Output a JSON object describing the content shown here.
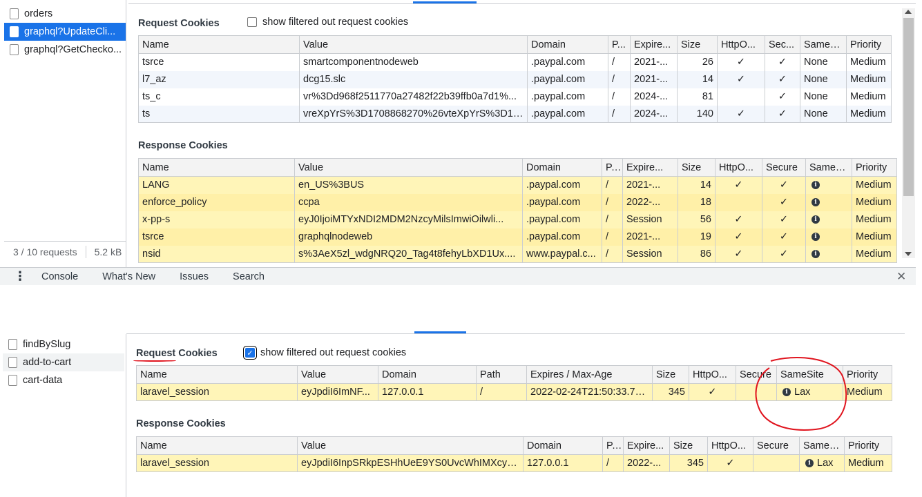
{
  "top": {
    "requests": [
      {
        "name": "orders"
      },
      {
        "name": "graphql?UpdateCli..."
      },
      {
        "name": "graphql?GetChecko..."
      }
    ],
    "status": {
      "requests": "3 / 10 requests",
      "size": "5.2 kB"
    },
    "request_cookies": {
      "title": "Request Cookies",
      "filter_label": "show filtered out request cookies",
      "filter_checked": false,
      "columns": [
        "Name",
        "Value",
        "Domain",
        "P...",
        "Expire...",
        "Size",
        "HttpO...",
        "Sec...",
        "SameS...",
        "Priority"
      ],
      "rows": [
        [
          "tsrce",
          "smartcomponentnodeweb",
          ".paypal.com",
          "/",
          "2021-...",
          "26",
          "✓",
          "✓",
          "None",
          "Medium"
        ],
        [
          "l7_az",
          "dcg15.slc",
          ".paypal.com",
          "/",
          "2021-...",
          "14",
          "✓",
          "✓",
          "None",
          "Medium"
        ],
        [
          "ts_c",
          "vr%3Dd968f2511770a27482f22b39ffb0a7d1%...",
          ".paypal.com",
          "/",
          "2024-...",
          "81",
          "",
          "✓",
          "None",
          "Medium"
        ],
        [
          "ts",
          "vreXpYrS%3D1708868270%26vteXpYrS%3D16...",
          ".paypal.com",
          "/",
          "2024-...",
          "140",
          "✓",
          "✓",
          "None",
          "Medium"
        ]
      ]
    },
    "response_cookies": {
      "title": "Response Cookies",
      "columns": [
        "Name",
        "Value",
        "Domain",
        "P...",
        "Expire...",
        "Size",
        "HttpO...",
        "Secure",
        "SameS...",
        "Priority"
      ],
      "rows": [
        [
          "LANG",
          "en_US%3BUS",
          ".paypal.com",
          "/",
          "2021-...",
          "14",
          "✓",
          "✓",
          "",
          "Medium"
        ],
        [
          "enforce_policy",
          "ccpa",
          ".paypal.com",
          "/",
          "2022-...",
          "18",
          "",
          "✓",
          "",
          "Medium"
        ],
        [
          "x-pp-s",
          "eyJ0IjoiMTYxNDI2MDM2NzcyMilsImwiOilwli...",
          ".paypal.com",
          "/",
          "Session",
          "56",
          "✓",
          "✓",
          "",
          "Medium"
        ],
        [
          "tsrce",
          "graphqlnodeweb",
          ".paypal.com",
          "/",
          "2021-...",
          "19",
          "✓",
          "✓",
          "",
          "Medium"
        ],
        [
          "nsid",
          "s%3AeX5zl_wdgNRQ20_Tag4t8fehyLbXD1Ux....",
          "www.paypal.c...",
          "/",
          "Session",
          "86",
          "✓",
          "✓",
          "",
          "Medium"
        ]
      ]
    },
    "drawer_tabs": [
      "Console",
      "What's New",
      "Issues",
      "Search"
    ],
    "close_glyph": "✕",
    "more_glyph": "⋮"
  },
  "bottom": {
    "requests": [
      {
        "name": "findBySlug"
      },
      {
        "name": "add-to-cart"
      },
      {
        "name": "cart-data"
      }
    ],
    "request_cookies": {
      "title": "Request Cookies",
      "filter_label": "show filtered out request cookies",
      "filter_checked": true,
      "columns": [
        "Name",
        "Value",
        "Domain",
        "Path",
        "Expires / Max-Age",
        "Size",
        "HttpO...",
        "Secure",
        "SameSite",
        "Priority"
      ],
      "rows": [
        [
          "laravel_session",
          "eyJpdiI6ImNF...",
          "127.0.0.1",
          "/",
          "2022-02-24T21:50:33.79...",
          "345",
          "✓",
          "",
          "Lax",
          "Medium"
        ]
      ]
    },
    "response_cookies": {
      "title": "Response Cookies",
      "columns": [
        "Name",
        "Value",
        "Domain",
        "P...",
        "Expire...",
        "Size",
        "HttpO...",
        "Secure",
        "SameS...",
        "Priority"
      ],
      "rows": [
        [
          "laravel_session",
          "eyJpdiI6InpSRkpESHhUeE9YS0UvcWhIMXcyV...",
          "127.0.0.1",
          "/",
          "2022-...",
          "345",
          "✓",
          "",
          "Lax",
          "Medium"
        ]
      ]
    }
  },
  "colors": {
    "selected": "#1a73e8",
    "blocked_row": "#fff5b8",
    "annotation": "#e0141e"
  }
}
